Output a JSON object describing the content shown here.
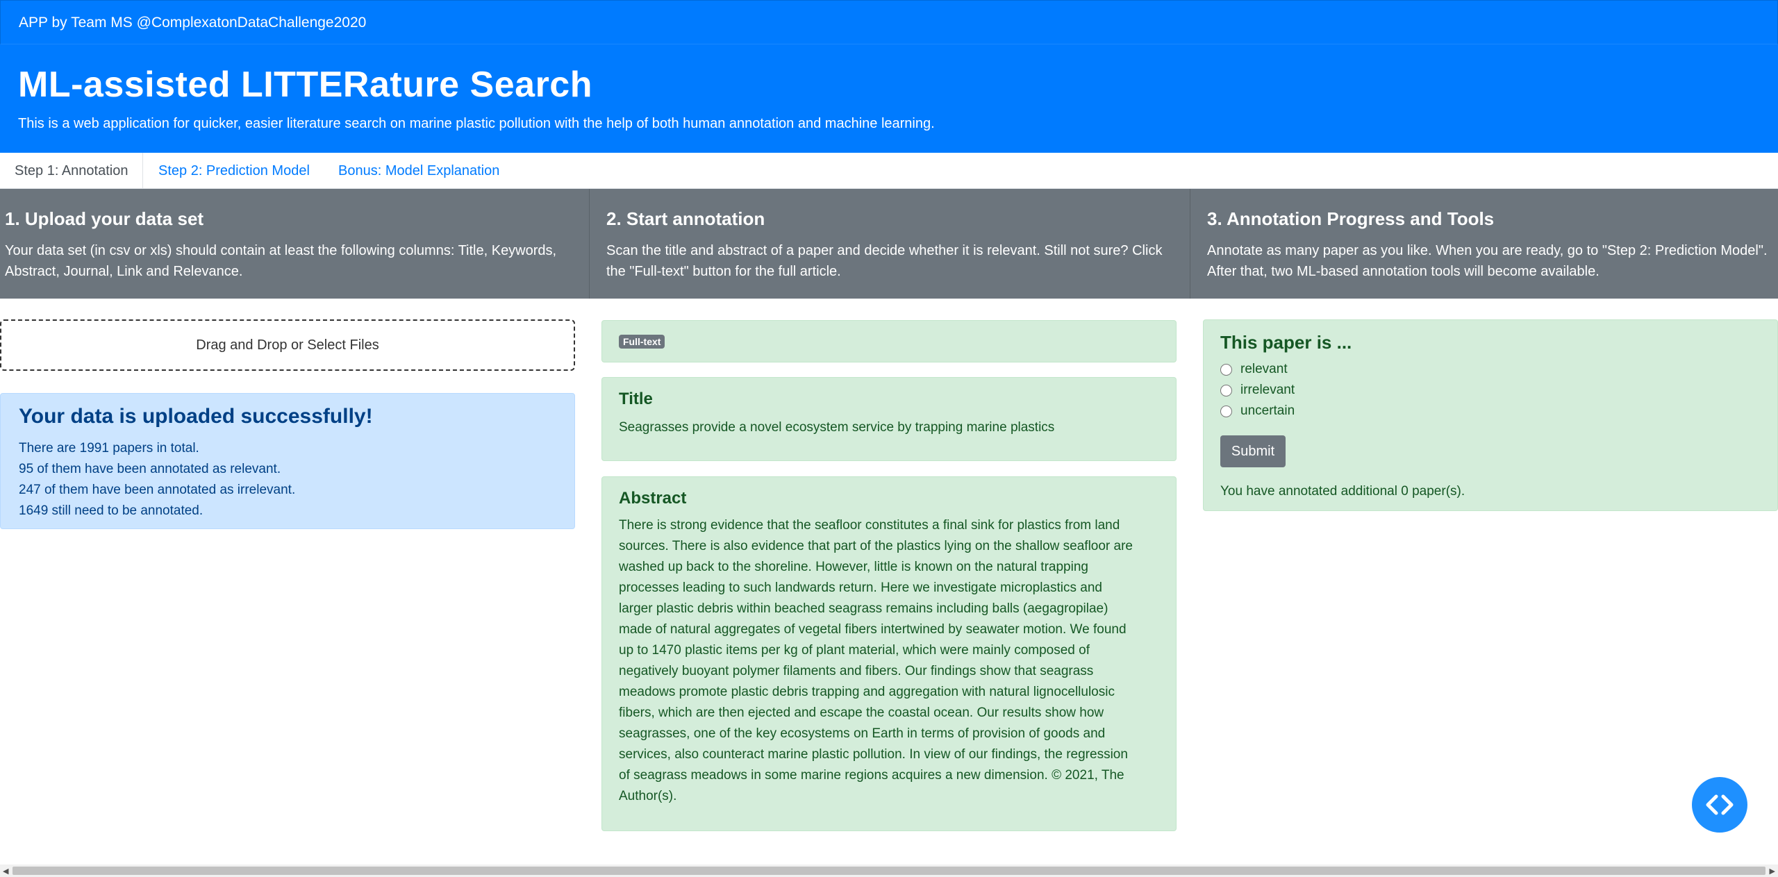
{
  "navbar": {
    "title": "APP by Team MS @ComplexatonDataChallenge2020"
  },
  "hero": {
    "title": "ML-assisted LITTERature Search",
    "subtitle": "This is a web application for quicker, easier literature search on marine plastic pollution with the help of both human annotation and machine learning."
  },
  "tabs": [
    {
      "label": "Step 1: Annotation"
    },
    {
      "label": "Step 2: Prediction Model"
    },
    {
      "label": "Bonus: Model Explanation"
    }
  ],
  "steps": [
    {
      "title": "1. Upload your data set",
      "lines": [
        "Your data set (in csv or xls) should contain at least the following columns: Title, Keywords,",
        "Abstract, Journal, Link and Relevance."
      ]
    },
    {
      "title": "2. Start annotation",
      "lines": [
        "Scan the title and abstract of a paper and decide whether it is relevant. Still not sure? Click",
        "the \"Full-text\" button for the full article."
      ]
    },
    {
      "title": "3. Annotation Progress and Tools",
      "lines": [
        "Annotate as many paper as you like. When you are ready, go to \"Step 2: Prediction Model\".",
        "After that, two ML-based annotation tools will become available."
      ]
    }
  ],
  "upload": {
    "label": "Drag and Drop or Select Files"
  },
  "status": {
    "heading": "Your data is uploaded successfully!",
    "lines": [
      "There are 1991 papers in total.",
      "95 of them have been annotated as relevant.",
      "247 of them have been annotated as irrelevant.",
      "1649 still need to be annotated."
    ]
  },
  "paper": {
    "fulltext_label": "Full-text",
    "title_heading": "Title",
    "title": "Seagrasses provide a novel ecosystem service by trapping marine plastics",
    "abstract_heading": "Abstract",
    "abstract_lines": [
      "There is strong evidence that the seafloor constitutes a final sink for plastics from land",
      "sources. There is also evidence that part of the plastics lying on the shallow seafloor are",
      "washed up back to the shoreline. However, little is known on the natural trapping",
      "processes leading to such landwards return. Here we investigate microplastics and",
      "larger plastic debris within beached seagrass remains including balls (aegagropilae)",
      "made of natural aggregates of vegetal fibers intertwined by seawater motion. We found",
      "up to 1470 plastic items per kg of plant material, which were mainly composed of",
      "negatively buoyant polymer filaments and fibers. Our findings show that seagrass",
      "meadows promote plastic debris trapping and aggregation with natural lignocellulosic",
      "fibers, which are then ejected and escape the coastal ocean. Our results show how",
      "seagrasses, one of the key ecosystems on Earth in terms of provision of goods and",
      "services, also counteract marine plastic pollution. In view of our findings, the regression",
      "of seagrass meadows in some marine regions acquires a new dimension. © 2021, The",
      "Author(s)."
    ]
  },
  "annotate": {
    "heading": "This paper is ...",
    "options": [
      "relevant",
      "irrelevant",
      "uncertain"
    ],
    "submit_label": "Submit",
    "counter": "You have annotated additional 0 paper(s)."
  },
  "colors": {
    "primary": "#007bff",
    "secondary": "#6c757d",
    "success_bg": "#d4edda",
    "info_bg": "#cce5ff"
  },
  "icons": {
    "fab": "code-icon"
  }
}
